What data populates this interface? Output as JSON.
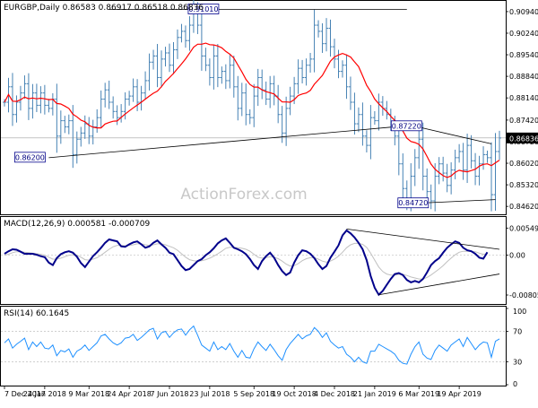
{
  "header": {
    "main_label": "EURGBP,Daily  0.86583 0.86917 0.86518 0.86836",
    "macd_label": "MACD(12,26,9) 0.000581 -0.000709",
    "rsi_label": "RSI(14) 60.1645",
    "watermark": "ActionForex.com"
  },
  "chart_data": [
    {
      "type": "candlestick",
      "title": "EURGBP,Daily",
      "ohlc_last": {
        "open": 0.86583,
        "high": 0.86917,
        "low": 0.86518,
        "close": 0.86836
      },
      "ylim": [
        0.8445,
        0.912
      ],
      "yticks": [
        "0.90940",
        "0.90240",
        "0.89540",
        "0.88840",
        "0.88140",
        "0.87420",
        "0.86720",
        "0.86020",
        "0.85320",
        "0.84620"
      ],
      "current_price_label": "0.86836",
      "x_tick_labels": [
        "7 Dec 2017",
        "24 Jan 2018",
        "9 Mar 2018",
        "24 Apr 2018",
        "7 Jun 2018",
        "23 Jul 2018",
        "5 Sep 2018",
        "19 Oct 2018",
        "4 Dec 2018",
        "21 Jan 2019",
        "6 Mar 2019",
        "19 Apr 2019"
      ],
      "annotations": [
        "0.91010",
        "0.87220",
        "0.86200",
        "0.84720"
      ],
      "close_values": [
        0.88,
        0.885,
        0.876,
        0.88,
        0.883,
        0.886,
        0.878,
        0.883,
        0.879,
        0.883,
        0.879,
        0.878,
        0.881,
        0.869,
        0.874,
        0.872,
        0.874,
        0.863,
        0.868,
        0.87,
        0.873,
        0.869,
        0.872,
        0.875,
        0.881,
        0.884,
        0.88,
        0.877,
        0.875,
        0.877,
        0.881,
        0.882,
        0.885,
        0.88,
        0.883,
        0.887,
        0.893,
        0.895,
        0.888,
        0.894,
        0.896,
        0.892,
        0.897,
        0.901,
        0.903,
        0.9,
        0.905,
        0.91,
        0.905,
        0.895,
        0.892,
        0.888,
        0.895,
        0.888,
        0.89,
        0.887,
        0.892,
        0.885,
        0.878,
        0.883,
        0.876,
        0.875,
        0.882,
        0.888,
        0.884,
        0.881,
        0.886,
        0.882,
        0.876,
        0.87,
        0.878,
        0.882,
        0.886,
        0.891,
        0.888,
        0.892,
        0.894,
        0.905,
        0.903,
        0.899,
        0.904,
        0.898,
        0.894,
        0.89,
        0.892,
        0.885,
        0.88,
        0.873,
        0.876,
        0.869,
        0.866,
        0.875,
        0.874,
        0.88,
        0.878,
        0.876,
        0.873,
        0.869,
        0.86,
        0.852,
        0.848,
        0.856,
        0.862,
        0.868,
        0.856,
        0.851,
        0.848,
        0.856,
        0.86,
        0.857,
        0.853,
        0.858,
        0.862,
        0.864,
        0.858,
        0.866,
        0.861,
        0.856,
        0.86,
        0.863,
        0.862,
        0.85,
        0.864,
        0.8684
      ],
      "series": [
        {
          "name": "EURGBP",
          "role": "price",
          "color": "#4682b4"
        },
        {
          "role": "moving-average",
          "color": "#ff0000"
        }
      ],
      "grid": false
    },
    {
      "type": "line",
      "title": "MACD(12,26,9)",
      "values_label": "0.000581 -0.000709",
      "ylim": [
        -0.0095,
        0.007
      ],
      "yticks": [
        "0.00549",
        "0.00",
        "-0.00805"
      ],
      "series": [
        {
          "role": "macd",
          "color": "#00008b",
          "values": [
            0.0003,
            0.0008,
            0.0012,
            0.0011,
            0.0007,
            0.0003,
            0.0003,
            0.0003,
            0.0001,
            -0.0002,
            -0.0004,
            -0.0015,
            -0.002,
            -0.0006,
            0.0002,
            0.0006,
            0.0008,
            0.0005,
            -0.0003,
            -0.0016,
            -0.0024,
            -0.0013,
            -0.0002,
            0.0006,
            0.0015,
            0.0025,
            0.0032,
            0.003,
            0.0028,
            0.0018,
            0.0017,
            0.0022,
            0.0026,
            0.0028,
            0.0022,
            0.0015,
            0.0018,
            0.0025,
            0.003,
            0.0022,
            0.0015,
            0.0005,
            0.0002,
            -0.001,
            -0.0022,
            -0.003,
            -0.0028,
            -0.002,
            -0.0012,
            -0.0008,
            0.0,
            0.0006,
            0.0014,
            0.0024,
            0.003,
            0.0034,
            0.0025,
            0.0015,
            0.0012,
            0.0008,
            0.0002,
            -0.0008,
            -0.002,
            -0.0028,
            -0.0012,
            -0.0002,
            0.0005,
            -0.0005,
            -0.002,
            -0.0032,
            -0.004,
            -0.0035,
            -0.0015,
            0.0,
            0.001,
            0.0008,
            0.0003,
            -0.0006,
            -0.0018,
            -0.0028,
            -0.0022,
            -0.0005,
            0.0007,
            0.002,
            0.004,
            0.005,
            0.0044,
            0.0036,
            0.0025,
            0.0012,
            -0.001,
            -0.0042,
            -0.0066,
            -0.008,
            -0.0072,
            -0.006,
            -0.0048,
            -0.0038,
            -0.0036,
            -0.004,
            -0.005,
            -0.0055,
            -0.0052,
            -0.0055,
            -0.0048,
            -0.0035,
            -0.002,
            -0.0012,
            -0.0006,
            0.0005,
            0.0015,
            0.0022,
            0.0028,
            0.0025,
            0.0015,
            0.001,
            0.0008,
            0.0003,
            -0.0005,
            -0.0007,
            0.0006
          ]
        },
        {
          "role": "signal",
          "color": "#c0c0c0",
          "values": [
            0.0,
            0.0002,
            0.0005,
            0.0007,
            0.0007,
            0.0006,
            0.0005,
            0.0004,
            0.0003,
            0.0002,
            0.0,
            -0.0004,
            -0.0008,
            -0.0008,
            -0.0006,
            -0.0003,
            0.0,
            0.0001,
            0.0,
            -0.0004,
            -0.0009,
            -0.001,
            -0.0008,
            -0.0005,
            0.0,
            0.0006,
            0.0012,
            0.0017,
            0.002,
            0.002,
            0.0019,
            0.002,
            0.0021,
            0.0023,
            0.0023,
            0.0021,
            0.002,
            0.0021,
            0.0023,
            0.0023,
            0.0021,
            0.0018,
            0.0015,
            0.001,
            0.0003,
            -0.0004,
            -0.0009,
            -0.0011,
            -0.0012,
            -0.0011,
            -0.0009,
            -0.0006,
            -0.0002,
            0.0003,
            0.0008,
            0.0014,
            0.0016,
            0.0016,
            0.0015,
            0.0014,
            0.0012,
            0.0008,
            0.0002,
            -0.0004,
            -0.0006,
            -0.0005,
            -0.0003,
            -0.0004,
            -0.0007,
            -0.0012,
            -0.0018,
            -0.0022,
            -0.0021,
            -0.0017,
            -0.0011,
            -0.0007,
            -0.0005,
            -0.0005,
            -0.0008,
            -0.0012,
            -0.0014,
            -0.0012,
            -0.0008,
            -0.0002,
            0.0006,
            0.0015,
            0.0021,
            0.0024,
            0.0024,
            0.0022,
            0.0016,
            0.0004,
            -0.001,
            -0.0024,
            -0.0033,
            -0.0038,
            -0.004,
            -0.004,
            -0.0039,
            -0.0039,
            -0.0041,
            -0.0044,
            -0.0046,
            -0.0048,
            -0.0048,
            -0.0045,
            -0.004,
            -0.0034,
            -0.0028,
            -0.0021,
            -0.0013,
            -0.0006,
            0.0001,
            0.0006,
            0.0008,
            0.0008,
            0.0008,
            0.0007,
            0.0004,
            0.0002,
            0.0003
          ]
        }
      ]
    },
    {
      "type": "line",
      "title": "RSI(14)",
      "value_label": "60.1645",
      "ylim": [
        0,
        100
      ],
      "yticks": [
        "100",
        "70",
        "30",
        "0"
      ],
      "series": [
        {
          "name": "RSI(14)",
          "color": "#1e90ff",
          "values": [
            55,
            60,
            48,
            53,
            57,
            61,
            46,
            56,
            50,
            56,
            48,
            47,
            52,
            38,
            45,
            43,
            47,
            36,
            44,
            47,
            52,
            45,
            50,
            55,
            64,
            66,
            60,
            55,
            52,
            55,
            61,
            62,
            66,
            58,
            62,
            67,
            72,
            74,
            60,
            68,
            70,
            62,
            68,
            72,
            73,
            65,
            72,
            77,
            65,
            52,
            48,
            44,
            56,
            46,
            50,
            46,
            54,
            44,
            36,
            45,
            36,
            35,
            47,
            56,
            50,
            45,
            53,
            46,
            38,
            32,
            46,
            54,
            60,
            66,
            60,
            64,
            66,
            75,
            70,
            62,
            68,
            57,
            52,
            48,
            50,
            40,
            36,
            30,
            36,
            30,
            28,
            44,
            44,
            53,
            50,
            47,
            44,
            40,
            32,
            28,
            27,
            40,
            50,
            56,
            40,
            35,
            33,
            45,
            52,
            48,
            44,
            52,
            56,
            60,
            50,
            62,
            54,
            46,
            52,
            56,
            55,
            36,
            57,
            60.16
          ]
        }
      ]
    }
  ]
}
